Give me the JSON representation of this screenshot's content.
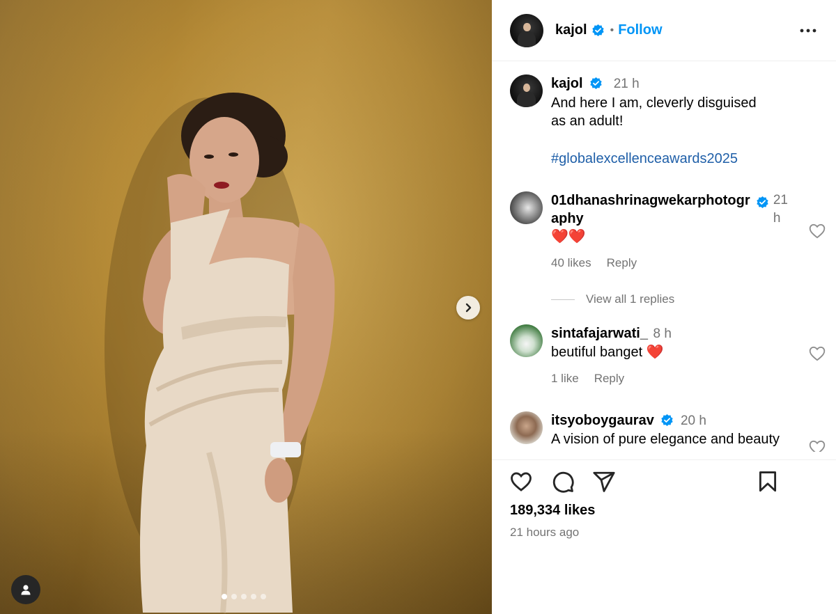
{
  "post": {
    "author": "kajol",
    "follow_label": "Follow",
    "caption": {
      "username": "kajol",
      "time": "21 h",
      "line1": "And here I am, cleverly disguised",
      "line2": "as an adult!",
      "hashtag": "#globalexcellenceawards2025"
    },
    "likes": "189,334 likes",
    "posted_ago": "21 hours ago",
    "carousel": {
      "slides": 5,
      "active_index": 0
    }
  },
  "comments": [
    {
      "username_line1": "01dhanashrinagwekarphotogr",
      "username_line2": "aphy",
      "time_line1": "21",
      "time_line2": "h",
      "text": "❤️❤️",
      "likes": "40 likes",
      "reply_label": "Reply",
      "view_replies": "View all 1 replies"
    },
    {
      "username": "sintafajarwati_",
      "time": "8 h",
      "text": "beutiful banget ❤️",
      "likes": "1 like",
      "reply_label": "Reply"
    },
    {
      "username": "itsyoboygaurav",
      "time": "20 h",
      "text": "A vision of pure elegance and beauty"
    }
  ],
  "colors": {
    "accent_blue": "#0095f6",
    "muted_text": "#737373",
    "verified_blue": "#0095f6"
  },
  "icons": {
    "header": [
      "verified-badge-icon",
      "more-options-icon"
    ],
    "actions": [
      "heart-icon",
      "comment-icon",
      "share-icon",
      "bookmark-icon"
    ],
    "media": [
      "chevron-right-icon",
      "user-tag-icon"
    ]
  }
}
